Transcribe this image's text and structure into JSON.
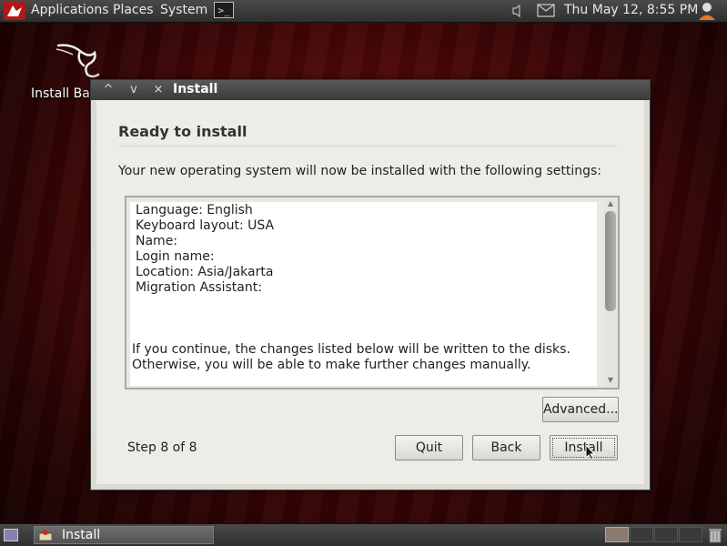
{
  "top_panel": {
    "menus": [
      "Applications",
      "Places",
      "System"
    ],
    "terminal_glyph": ">_",
    "clock": "Thu May 12,  8:55 PM",
    "icons": [
      "backtrack-logo-icon",
      "terminal-icon",
      "volume-icon",
      "mail-icon",
      "user-icon"
    ]
  },
  "desktop": {
    "icon_label": "Install Bac"
  },
  "window": {
    "title": "Install",
    "controls": [
      "^",
      "v",
      "×"
    ],
    "heading": "Ready to install",
    "intro": "Your new operating system will now be installed with the following settings:",
    "summary_lines": [
      "Language: English",
      "Keyboard layout: USA",
      "Name:",
      "Login name:",
      "Location: Asia/Jakarta",
      "Migration Assistant:"
    ],
    "notice_lines": [
      "If you continue, the changes listed below will be written to the disks.",
      "Otherwise, you will be able to make further changes manually."
    ],
    "scroll_arrows": [
      "▲",
      "▼"
    ],
    "advanced_label": "Advanced...",
    "step_text": "Step 8 of 8",
    "buttons": {
      "quit": "Quit",
      "back": "Back",
      "install": "Install"
    }
  },
  "bottom_panel": {
    "task_label": "Install",
    "workspaces": 4,
    "active_workspace": 1
  },
  "colors": {
    "panel_bg": "#3a3a3a",
    "window_bg": "#edece7",
    "wallpaper": "#5a0c0c"
  }
}
